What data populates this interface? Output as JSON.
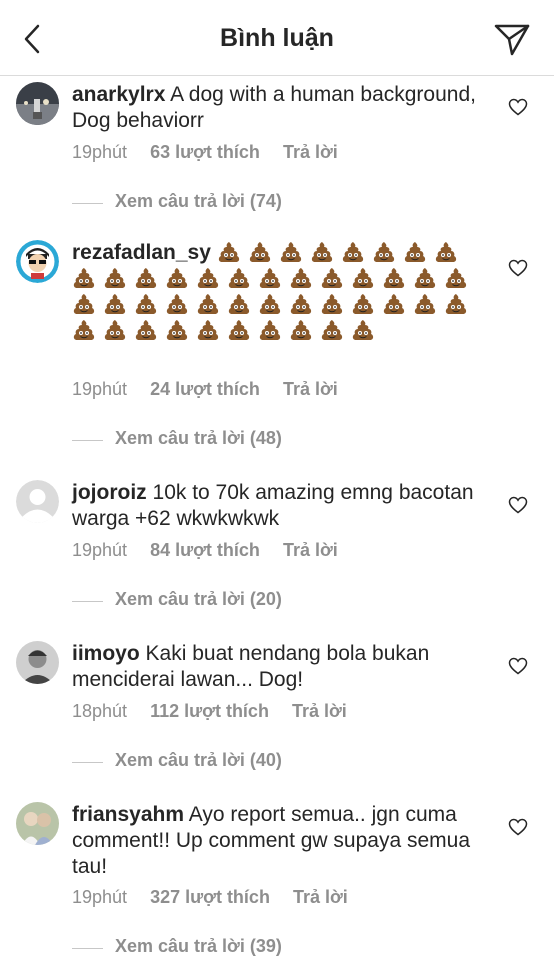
{
  "header": {
    "title": "Bình luận"
  },
  "icons": {
    "back": "chevron-left-icon",
    "direct": "paper-plane-icon",
    "like": "heart-outline-icon",
    "emoji": "pile-of-poo-emoji"
  },
  "colors": {
    "text": "#262626",
    "meta": "#8e8e8e",
    "divider": "#dbdbdb"
  },
  "comments": [
    {
      "username": "anarkylrx",
      "text": "A dog with a human background, Dog behaviorr",
      "time": "19phút",
      "likes": "63 lượt thích",
      "reply": "Trả lời",
      "view_replies": "Xem câu trả lời (74)"
    },
    {
      "username": "rezafadlan_sy",
      "text": "",
      "emoji_count": 44,
      "emoji": "💩",
      "time": "19phút",
      "likes": "24 lượt thích",
      "reply": "Trả lời",
      "view_replies": "Xem câu trả lời (48)"
    },
    {
      "username": "jojoroiz",
      "text": "10k to 70k amazing emng bacotan warga +62 wkwkwkwk",
      "time": "19phút",
      "likes": "84 lượt thích",
      "reply": "Trả lời",
      "view_replies": "Xem câu trả lời (20)"
    },
    {
      "username": "iimoyo",
      "text": "Kaki buat nendang bola bukan menciderai lawan... Dog!",
      "time": "18phút",
      "likes": "112 lượt thích",
      "reply": "Trả lời",
      "view_replies": "Xem câu trả lời (40)"
    },
    {
      "username": "friansyahm",
      "text": "Ayo report semua.. jgn cuma comment!! Up comment gw supaya semua tau!",
      "time": "19phút",
      "likes": "327 lượt thích",
      "reply": "Trả lời",
      "view_replies": "Xem câu trả lời (39)"
    }
  ]
}
